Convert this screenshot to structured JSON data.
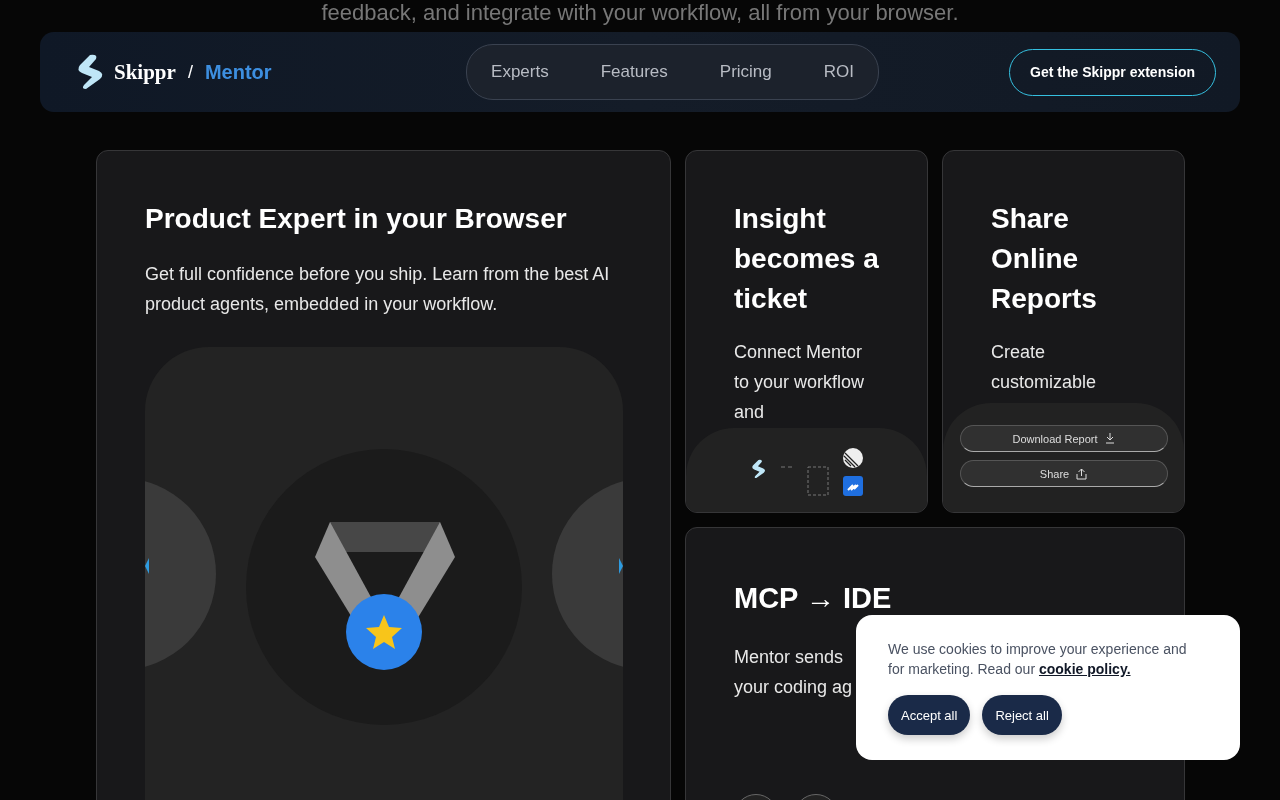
{
  "hero_tagline": "feedback, and integrate with your workflow, all from your browser.",
  "navbar": {
    "brand": "Skippr",
    "separator": "/",
    "product": "Mentor",
    "links": [
      {
        "label": "Experts"
      },
      {
        "label": "Features"
      },
      {
        "label": "Pricing"
      },
      {
        "label": "ROI"
      }
    ],
    "cta": "Get the Skippr extension"
  },
  "cards": [
    {
      "kind": "hero",
      "title": "Product Expert in your Browser",
      "text": "Get full confidence before you ship. Learn from the best AI product agents, embedded in your workflow."
    },
    {
      "kind": "integrations",
      "title": "Insight becomes a ticket",
      "text": "Connect Mentor to your workflow and"
    },
    {
      "kind": "reports",
      "title": "Share Online Reports",
      "text": "Create customizable",
      "buttons": [
        {
          "label": "Download Report",
          "kind": "download"
        },
        {
          "label": "Share",
          "kind": "share"
        }
      ]
    },
    {
      "kind": "mcp",
      "title": "MCP → IDE",
      "text": "Mentor sends\nyour coding ag"
    }
  ],
  "cookie_banner": {
    "text": "We use cookies to improve your experience and for marketing. Read our",
    "link": "cookie policy.",
    "buttons": [
      "Accept all",
      "Reject all"
    ]
  }
}
